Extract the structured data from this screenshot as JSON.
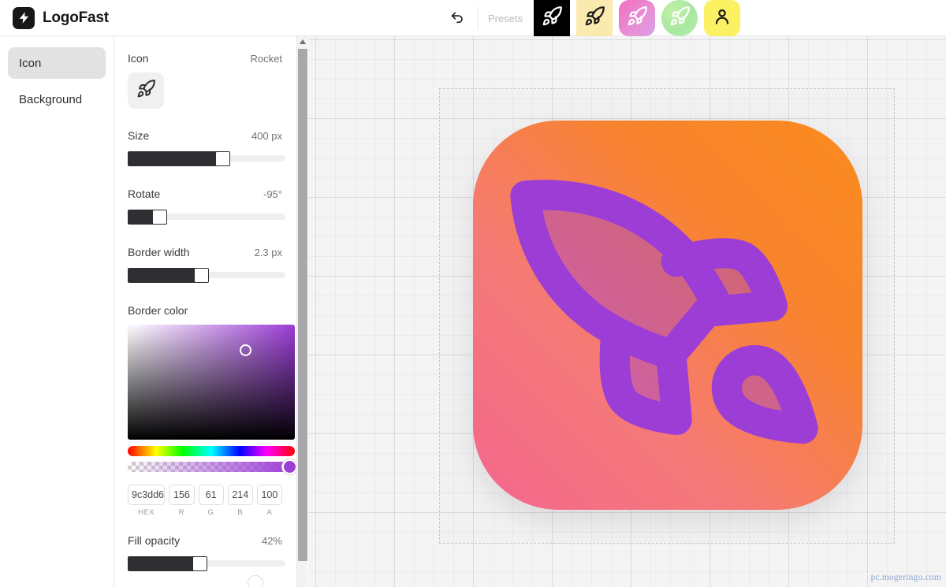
{
  "app": {
    "brand_name": "LogoFast",
    "brand_icon": "lightning-bolt-icon"
  },
  "header": {
    "undo_icon": "undo-arrow-icon",
    "presets_label": "Presets",
    "presets": [
      {
        "id": "preset-1",
        "icon": "rocket-icon",
        "shape": "square",
        "bg": "#000000",
        "icon_color": "#ffffff"
      },
      {
        "id": "preset-2",
        "icon": "rocket-icon",
        "shape": "square",
        "bg": "#fbeaae",
        "icon_color": "#1a1a1a"
      },
      {
        "id": "preset-3",
        "icon": "rocket-icon",
        "shape": "rounded",
        "bg": "#f06fc0",
        "icon_color": "#ffffff"
      },
      {
        "id": "preset-4",
        "icon": "rocket-icon",
        "shape": "circle",
        "bg": "#a8e8a0",
        "icon_color": "#ffffff"
      },
      {
        "id": "preset-5",
        "icon": "person-icon",
        "shape": "rounded",
        "bg": "#fbf162",
        "icon_color": "#1a1a1a"
      }
    ]
  },
  "sidebar": {
    "items": [
      {
        "label": "Icon",
        "active": true
      },
      {
        "label": "Background",
        "active": false
      }
    ]
  },
  "panel": {
    "icon": {
      "label": "Icon",
      "value": "Rocket",
      "button_icon": "rocket-icon"
    },
    "size": {
      "label": "Size",
      "value": "400 px",
      "percent": 58
    },
    "rotate": {
      "label": "Rotate",
      "value": "-95°",
      "percent": 17
    },
    "border_width": {
      "label": "Border width",
      "value": "2.3 px",
      "percent": 42
    },
    "border_color": {
      "label": "Border color",
      "hex": "9c3dd6",
      "r": "156",
      "g": "61",
      "b": "214",
      "a": "100",
      "hex_sub": "HEX",
      "r_sub": "R",
      "g_sub": "G",
      "b_sub": "B",
      "a_sub": "A"
    },
    "fill_opacity": {
      "label": "Fill opacity",
      "value": "42%",
      "percent": 42
    }
  },
  "canvas": {
    "logo": {
      "icon": "rocket-icon",
      "gradient_from": "#f4678e",
      "gradient_to": "#fa8b1e",
      "icon_stroke_color": "#9c3dd6",
      "icon_fill_opacity": "42%",
      "rotation": "-95°"
    },
    "watermark": "pc.mogeringo.com"
  }
}
